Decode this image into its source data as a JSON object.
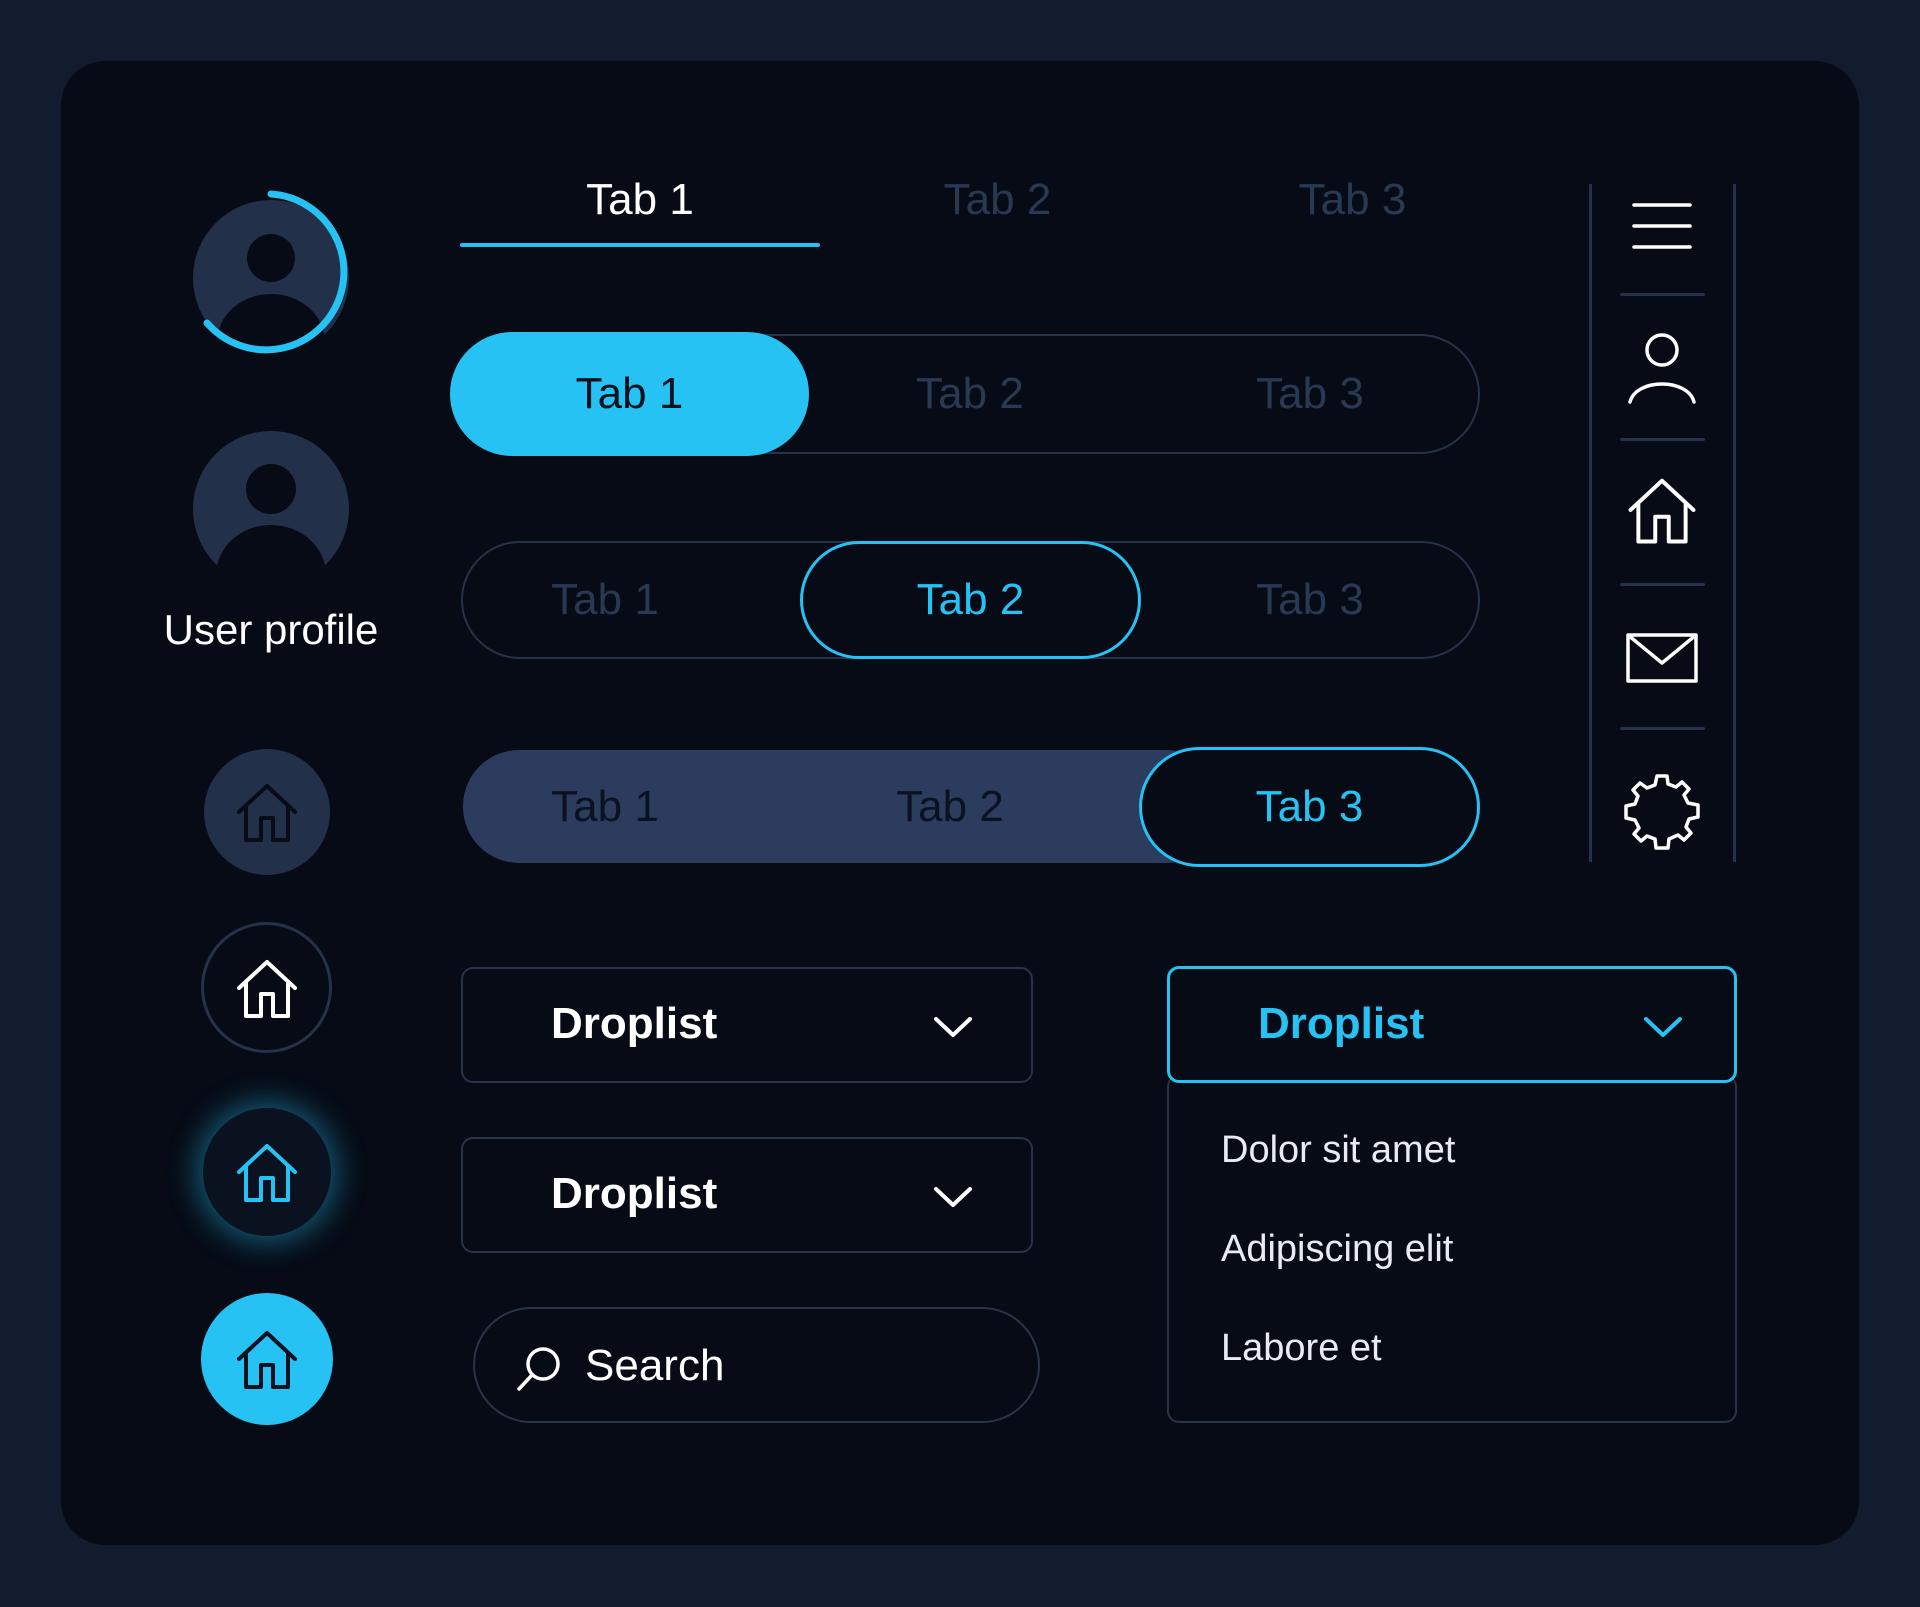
{
  "profile": {
    "label": "User profile"
  },
  "underline_tabs": [
    {
      "label": "Tab 1",
      "state": "active"
    },
    {
      "label": "Tab 2",
      "state": "inactive"
    },
    {
      "label": "Tab 3",
      "state": "inactive"
    }
  ],
  "pill_tabs_filled": [
    {
      "label": "Tab 1",
      "state": "active"
    },
    {
      "label": "Tab 2",
      "state": "inactive"
    },
    {
      "label": "Tab 3",
      "state": "inactive"
    }
  ],
  "pill_tabs_outline": [
    {
      "label": "Tab 1",
      "state": "inactive"
    },
    {
      "label": "Tab 2",
      "state": "active"
    },
    {
      "label": "Tab 3",
      "state": "inactive"
    }
  ],
  "pill_tabs_solid": [
    {
      "label": "Tab 1",
      "state": "inactive"
    },
    {
      "label": "Tab 2",
      "state": "inactive"
    },
    {
      "label": "Tab 3",
      "state": "active"
    }
  ],
  "droplists": [
    {
      "label": "Droplist",
      "state": "closed"
    },
    {
      "label": "Droplist",
      "state": "closed"
    },
    {
      "label": "Droplist",
      "state": "open"
    }
  ],
  "dropdown_options": [
    "Dolor sit amet",
    "Adipiscing elit",
    "Labore et"
  ],
  "search": {
    "placeholder": "Search"
  },
  "sidebar_icons": [
    "menu-icon",
    "user-icon",
    "home-icon",
    "mail-icon",
    "settings-icon"
  ],
  "colors": {
    "accent": "#26c2f4",
    "panel": "#060b15",
    "background": "#131b2e",
    "muted": "#2a3952",
    "avatar": "#22304a"
  }
}
